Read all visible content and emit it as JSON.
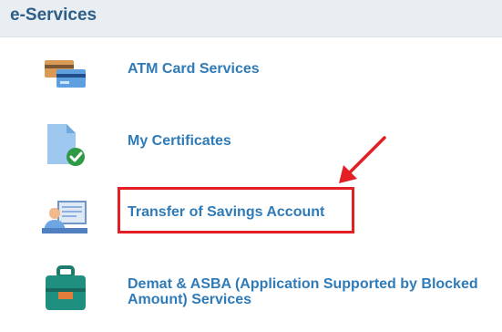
{
  "header": {
    "title": "e-Services"
  },
  "services": [
    {
      "label": "ATM Card Services",
      "icon": "atm-cards-icon"
    },
    {
      "label": "My Certificates",
      "icon": "certificate-check-icon"
    },
    {
      "label": "Transfer of Savings Account",
      "icon": "customer-counter-icon",
      "highlighted": true
    },
    {
      "label_line1": "Demat & ASBA (Application Supported by Blocked",
      "label_line2": "Amount) Services",
      "icon": "green-briefcase-icon"
    }
  ],
  "annotation": {
    "color": "#e31e24",
    "icon": "red-arrow-icon"
  },
  "colors": {
    "header_bg": "#e8eef2",
    "header_text": "#2e5d86",
    "link": "#2f7bb8"
  }
}
